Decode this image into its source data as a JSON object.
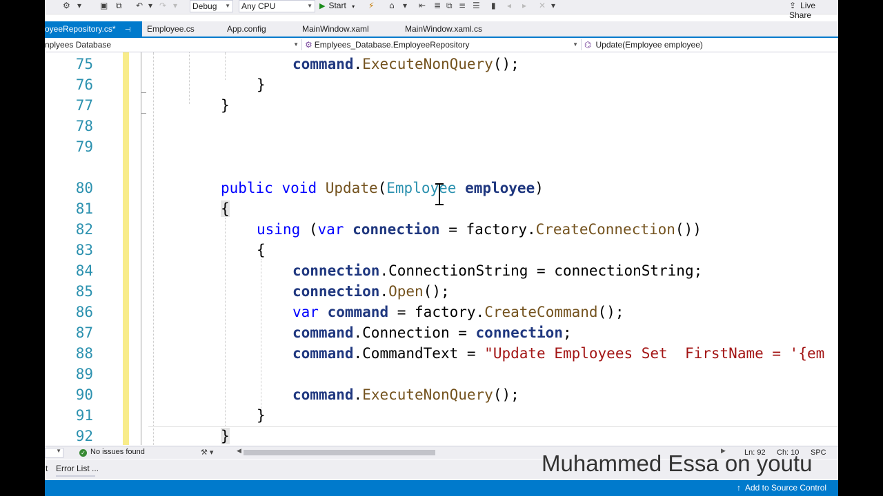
{
  "toolbar": {
    "config": "Debug",
    "platform": "Any CPU",
    "start": "Start",
    "live_share": "Live Share"
  },
  "tabs": [
    {
      "label": "oyeeRepository.cs*",
      "active": true
    },
    {
      "label": "Employee.cs"
    },
    {
      "label": "App.config"
    },
    {
      "label": "MainWindow.xaml"
    },
    {
      "label": "MainWindow.xaml.cs"
    }
  ],
  "navbar": {
    "project": "nplyees Database",
    "class": "Emplyees_Database.EmployeeRepository",
    "member": "Update(Employee employee)"
  },
  "editor": {
    "line_numbers": [
      "75",
      "76",
      "77",
      "78",
      "79",
      "80",
      "81",
      "82",
      "83",
      "84",
      "85",
      "86",
      "87",
      "88",
      "89",
      "90",
      "91",
      "92"
    ],
    "code": {
      "l75": {
        "a": "command",
        "b": ".",
        "c": "ExecuteNonQuery",
        "d": "();"
      },
      "l76": "}",
      "l77": "}",
      "l80": {
        "kw1": "public",
        "kw2": "void",
        "m": "Update",
        "p1": "(",
        "ty": "Employee",
        "p2": " ",
        "prm": "employee",
        "p3": ")"
      },
      "l81": "{",
      "l82": {
        "kw": "using",
        "p1": " (",
        "kw2": "var",
        "p2": " ",
        "v": "connection",
        "p3": " = factory.",
        "m": "CreateConnection",
        "p4": "())"
      },
      "l83": "{",
      "l84": {
        "v": "connection",
        "p": ".ConnectionString = connectionString;"
      },
      "l85": {
        "v": "connection",
        "p": ".",
        "m": "Open",
        "p2": "();"
      },
      "l86": {
        "kw": "var",
        "p1": " ",
        "v": "command",
        "p2": " = factory.",
        "m": "CreateCommand",
        "p3": "();"
      },
      "l87": {
        "v": "command",
        "p": ".Connection = ",
        "v2": "connection",
        "p2": ";"
      },
      "l88": {
        "v": "command",
        "p": ".CommandText = ",
        "s": "\"Update Employees Set  FirstName = '{em"
      },
      "l90": {
        "v": "command",
        "p": ".",
        "m": "ExecuteNonQuery",
        "p2": "();"
      },
      "l91": "}",
      "l92": "}"
    }
  },
  "status": {
    "issues": "No issues found",
    "ln": "Ln: 92",
    "ch": "Ch: 10",
    "spc": "SPC",
    "error_list": "Error List ...",
    "error_sep": "t",
    "source_control": "Add to Source Control"
  },
  "watermark": "Muhammed Essa on youtu"
}
